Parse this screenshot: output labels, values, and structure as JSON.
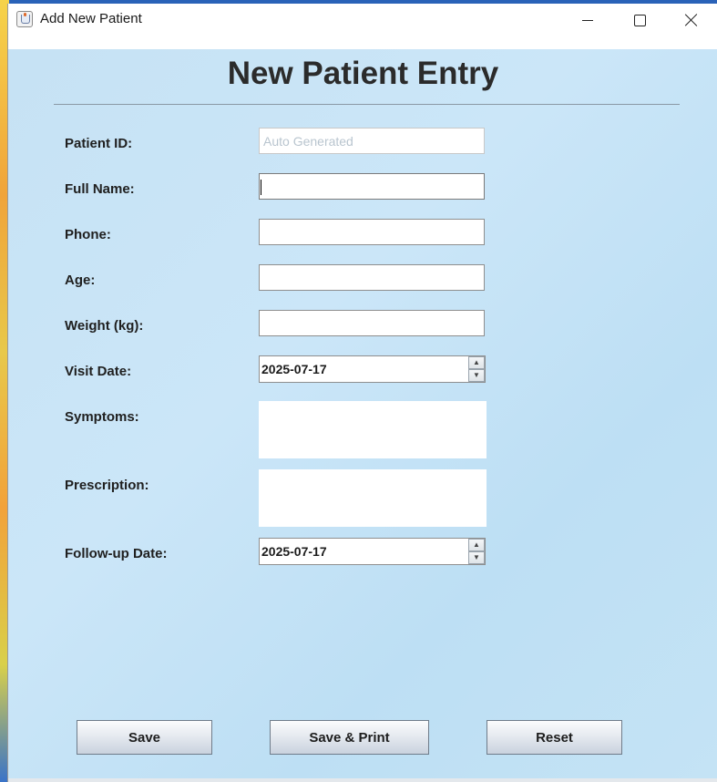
{
  "window": {
    "title": "Add New Patient",
    "controls": {
      "minimize": "minimize",
      "maximize": "maximize",
      "close": "close"
    }
  },
  "form": {
    "heading": "New Patient Entry",
    "fields": {
      "patient_id": {
        "label": "Patient ID:",
        "value": "",
        "placeholder": "Auto Generated"
      },
      "full_name": {
        "label": "Full Name:",
        "value": ""
      },
      "phone": {
        "label": "Phone:",
        "value": ""
      },
      "age": {
        "label": "Age:",
        "value": ""
      },
      "weight": {
        "label": "Weight (kg):",
        "value": ""
      },
      "visit_date": {
        "label": "Visit Date:",
        "value": "2025-07-17"
      },
      "symptoms": {
        "label": "Symptoms:",
        "value": ""
      },
      "prescription": {
        "label": "Prescription:",
        "value": ""
      },
      "followup_date": {
        "label": "Follow-up Date:",
        "value": "2025-07-17"
      }
    }
  },
  "buttons": {
    "save": "Save",
    "save_print": "Save & Print",
    "reset": "Reset"
  },
  "spinner_glyphs": {
    "up": "▲",
    "down": "▼"
  }
}
